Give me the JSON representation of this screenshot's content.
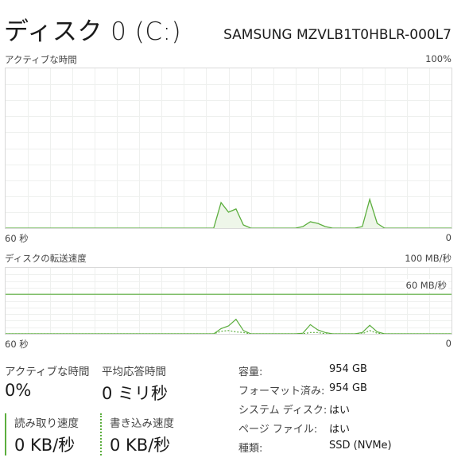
{
  "header": {
    "title": "ディスク 0 (C:)",
    "model": "SAMSUNG MZVLB1T0HBLR-000L7"
  },
  "active_chart": {
    "label": "アクティブな時間",
    "max_label": "100%",
    "x_left_label": "60 秒",
    "x_right_label": "0",
    "line_color": "#5cae3e",
    "fill_color": "#eef6e9"
  },
  "transfer_chart": {
    "label": "ディスクの転送速度",
    "max_label": "100 MB/秒",
    "ref_label": "60 MB/秒",
    "x_left_label": "60 秒",
    "x_right_label": "0",
    "line_color": "#5cae3e"
  },
  "chart_data": [
    {
      "type": "area",
      "title": "アクティブな時間",
      "ylim": [
        0,
        100
      ],
      "xlim": [
        60,
        0
      ],
      "x": [
        60,
        32,
        31,
        30,
        29,
        28,
        27,
        26,
        25,
        24,
        23,
        22,
        21,
        20,
        19,
        18,
        17,
        16,
        15,
        14,
        13,
        12,
        11,
        10,
        9,
        8,
        7,
        6,
        5,
        4,
        3,
        2,
        1,
        0
      ],
      "values": [
        0,
        0,
        16,
        10,
        12,
        2,
        0,
        0,
        0,
        0,
        0,
        0,
        0,
        1,
        4,
        3,
        1,
        0,
        0,
        0,
        0,
        1,
        18,
        3,
        0,
        0,
        0,
        0,
        0,
        0,
        0,
        0,
        0,
        0
      ]
    },
    {
      "type": "line",
      "title": "ディスクの転送速度",
      "ylim": [
        0,
        100
      ],
      "xlim": [
        60,
        0
      ],
      "reference_line": 60,
      "series": [
        {
          "values": [
            0,
            0,
            8,
            12,
            22,
            5,
            0,
            0,
            0,
            0,
            0,
            0,
            0,
            1,
            14,
            6,
            2,
            0,
            0,
            0,
            0,
            2,
            13,
            3,
            0,
            0,
            0,
            0,
            0,
            0,
            0,
            0,
            0,
            0
          ]
        },
        {
          "dashed": true,
          "values": [
            0,
            0,
            4,
            5,
            3,
            2,
            0,
            0,
            0,
            0,
            0,
            0,
            0,
            0,
            2,
            2,
            0,
            0,
            0,
            0,
            0,
            0,
            5,
            1,
            0,
            0,
            0,
            0,
            0,
            0,
            0,
            0,
            0,
            0
          ]
        }
      ]
    }
  ],
  "stats": {
    "active_time": {
      "label": "アクティブな時間",
      "value": "0%"
    },
    "avg_response": {
      "label": "平均応答時間",
      "value": "0 ミリ秒"
    },
    "read_speed": {
      "label": "読み取り速度",
      "value": "0 KB/秒"
    },
    "write_speed": {
      "label": "書き込み速度",
      "value": "0 KB/秒"
    }
  },
  "properties": [
    {
      "label": "容量:",
      "value": "954 GB"
    },
    {
      "label": "フォーマット済み:",
      "value": "954 GB"
    },
    {
      "label": "システム ディスク:",
      "value": "はい"
    },
    {
      "label": "ページ ファイル:",
      "value": "はい"
    },
    {
      "label": "種類:",
      "value": "SSD (NVMe)"
    }
  ]
}
